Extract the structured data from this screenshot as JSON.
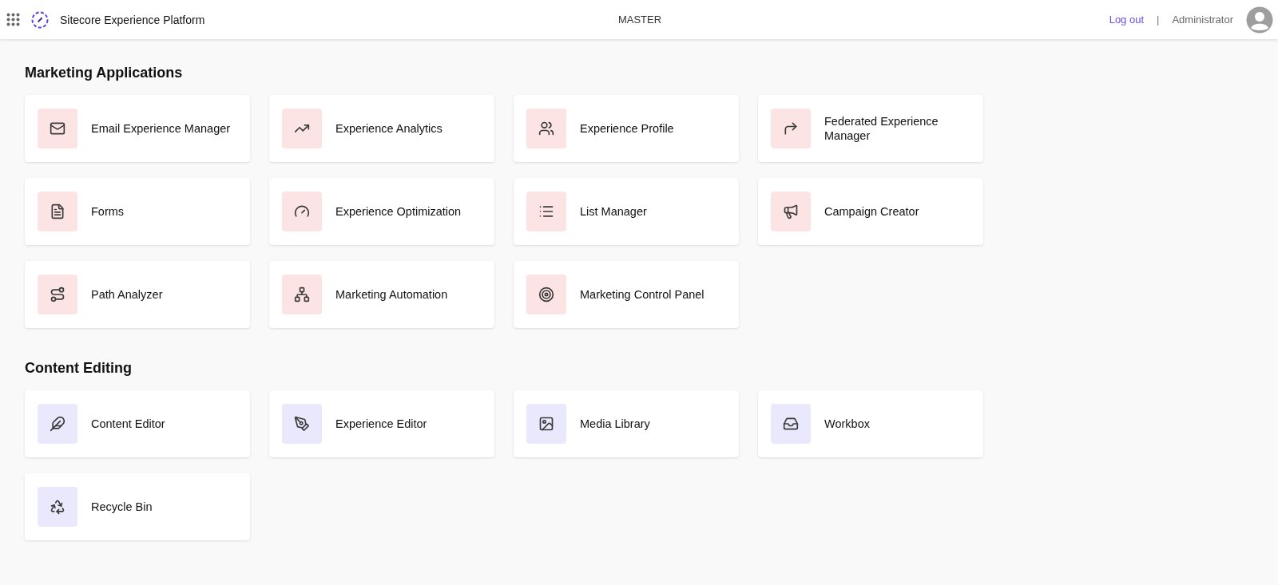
{
  "header": {
    "title": "Sitecore Experience Platform",
    "database": "MASTER",
    "logout": "Log out",
    "separator": "|",
    "user": "Administrator"
  },
  "sections": [
    {
      "title": "Marketing Applications",
      "color": "#fde4e4",
      "apps": [
        "Email Experience Manager",
        "Experience Analytics",
        "Experience Profile",
        "Federated Experience Manager",
        "Forms",
        "Experience Optimization",
        "List Manager",
        "Campaign Creator",
        "Path Analyzer",
        "Marketing Automation",
        "Marketing Control Panel"
      ]
    },
    {
      "title": "Content Editing",
      "color": "#eae8fc",
      "apps": [
        "Content Editor",
        "Experience Editor",
        "Media Library",
        "Workbox",
        "Recycle Bin"
      ]
    }
  ]
}
